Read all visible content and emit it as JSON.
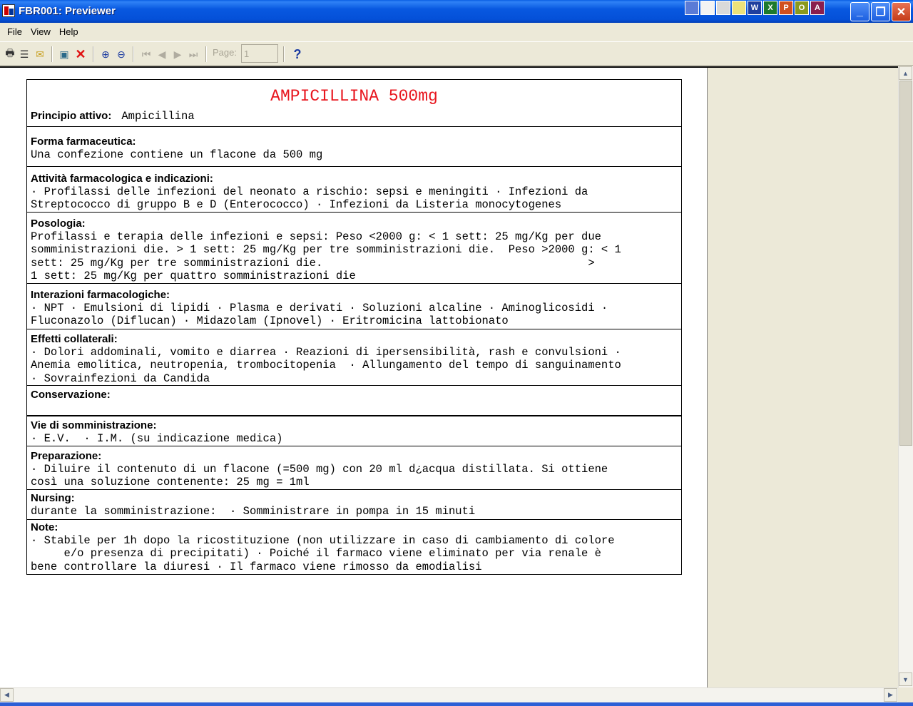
{
  "window": {
    "title": "FBR001: Previewer",
    "minimize_glyph": "_",
    "maximize_glyph": "❐",
    "close_glyph": "✕"
  },
  "menu": [
    "File",
    "View",
    "Help"
  ],
  "toolbar": {
    "page_label": "Page:",
    "page_value": "1",
    "help_glyph": "?",
    "icons": [
      "print-icon",
      "print-setup-icon",
      "mail-icon",
      "preview-icon",
      "close-icon",
      "zoom-in-icon",
      "zoom-out-icon",
      "first-page-icon",
      "prev-page-icon",
      "next-page-icon",
      "last-page-icon",
      "help-icon"
    ]
  },
  "colors": {
    "title_red": "#e8161e",
    "titlebar_blue": "#0450d8"
  },
  "document": {
    "title": "AMPICILLINA 500mg",
    "principio_label": "Principio attivo:",
    "principio_value": "Ampicillina",
    "sections": [
      {
        "label": "Forma farmaceutica:",
        "text": "Una confezione contiene un flacone da 500 mg"
      },
      {
        "label": "Attività farmacologica e indicazioni:",
        "text": "· Profilassi delle infezioni del neonato a rischio: sepsi e meningiti · Infezioni da\nStreptococco di gruppo B e D (Enterococco) · Infezioni da Listeria monocytogenes"
      },
      {
        "label": "Posologia:",
        "text": "Profilassi e terapia delle infezioni e sepsi: Peso <2000 g: < 1 sett: 25 mg/Kg per due\nsomministrazioni die. > 1 sett: 25 mg/Kg per tre somministrazioni die.  Peso >2000 g: < 1\nsett: 25 mg/Kg per tre somministrazioni die.                                        >\n1 sett: 25 mg/Kg per quattro somministrazioni die"
      },
      {
        "label": "Interazioni farmacologiche:",
        "text": "· NPT · Emulsioni di lipidi · Plasma e derivati · Soluzioni alcaline · Aminoglicosidi ·\nFluconazolo (Diflucan) · Midazolam (Ipnovel) · Eritromicina lattobionato"
      },
      {
        "label": "Effetti collaterali:",
        "text": "· Dolori addominali, vomito e diarrea · Reazioni di ipersensibilità, rash e convulsioni ·\nAnemia emolitica, neutropenia, trombocitopenia  · Allungamento del tempo di sanguinamento\n· Sovrainfezioni da Candida"
      },
      {
        "label": "Conservazione:",
        "text": ""
      },
      {
        "label": "Vie di somministrazione:",
        "text": "· E.V.  · I.M. (su indicazione medica)"
      },
      {
        "label": "Preparazione:",
        "text": "· Diluire il contenuto di un flacone (=500 mg) con 20 ml d¿acqua distillata. Si ottiene\ncosì una soluzione contenente: 25 mg = 1ml"
      },
      {
        "label": "Nursing:",
        "text": "durante la somministrazione:  · Somministrare in pompa in 15 minuti"
      },
      {
        "label": "Note:",
        "text": "· Stabile per 1h dopo la ricostituzione (non utilizzare in caso di cambiamento di colore\n     e/o presenza di precipitati) · Poiché il farmaco viene eliminato per via renale è\nbene controllare la diuresi · Il farmaco viene rimosso da emodialisi"
      }
    ]
  }
}
